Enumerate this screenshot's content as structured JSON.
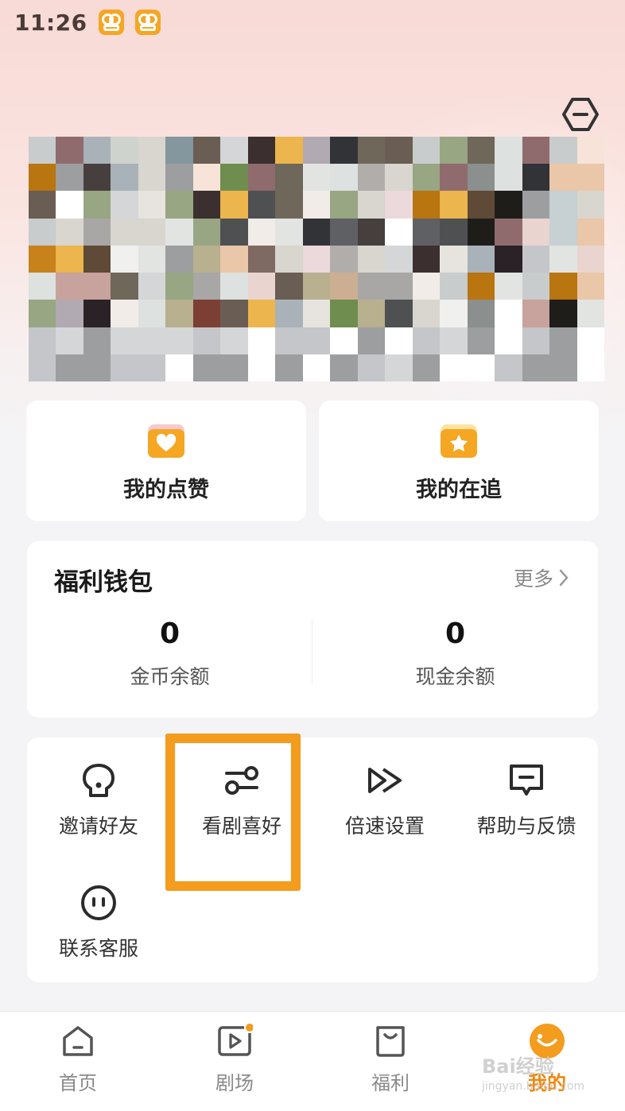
{
  "status_bar": {
    "time": "11:26",
    "app_icons": [
      "kuaishou-icon",
      "kuaishou-icon"
    ]
  },
  "header": {
    "settings_icon": "hexagon-settings-icon"
  },
  "quick_links": [
    {
      "label": "我的点赞",
      "icon": "heart-folder-icon"
    },
    {
      "label": "我的在追",
      "icon": "star-folder-icon"
    }
  ],
  "wallet": {
    "title": "福利钱包",
    "more": "更多",
    "items": [
      {
        "value": "0",
        "label": "金币余额"
      },
      {
        "value": "0",
        "label": "现金余额"
      }
    ]
  },
  "tools": [
    {
      "label": "邀请好友",
      "icon": "invite-friend-icon"
    },
    {
      "label": "看剧喜好",
      "icon": "preference-sliders-icon"
    },
    {
      "label": "倍速设置",
      "icon": "fast-forward-icon"
    },
    {
      "label": "帮助与反馈",
      "icon": "feedback-message-icon"
    },
    {
      "label": "联系客服",
      "icon": "customer-service-icon"
    }
  ],
  "tabbar": {
    "items": [
      {
        "label": "首页",
        "icon": "home-icon",
        "active": false
      },
      {
        "label": "剧场",
        "icon": "theater-play-icon",
        "active": false,
        "badge": true
      },
      {
        "label": "福利",
        "icon": "welfare-bag-icon",
        "active": false
      },
      {
        "label": "我的",
        "icon": "profile-avatar-icon",
        "active": true
      }
    ]
  },
  "watermark": {
    "text": "Bai经验",
    "sub": "jingyan.baidu.com"
  },
  "colors": {
    "accent": "#f39c1e",
    "active_tab": "#f0870c",
    "card_bg": "#ffffff"
  }
}
